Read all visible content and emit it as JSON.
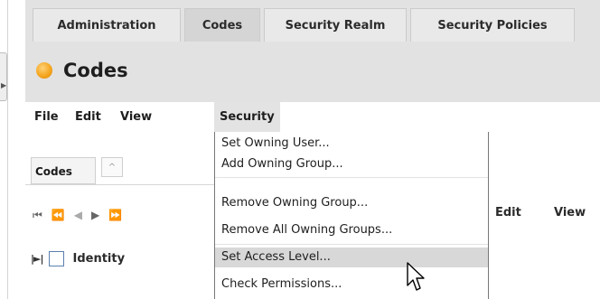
{
  "header": {
    "tabs": [
      {
        "label": "Administration",
        "active": false
      },
      {
        "label": "Codes",
        "active": true
      },
      {
        "label": "Security Realm",
        "active": false
      },
      {
        "label": "Security Policies",
        "active": false
      }
    ],
    "title": "Codes",
    "status_icon": "orange-dot-icon"
  },
  "menubar": {
    "items": [
      "File",
      "Edit",
      "View",
      "Security"
    ]
  },
  "security_menu": {
    "items": [
      "Set Owning User...",
      "Add Owning Group...",
      "Remove Owning Group...",
      "Remove All Owning Groups...",
      "Set Access Level...",
      "Check Permissions..."
    ],
    "hovered": "Set Access Level..."
  },
  "codes_panel": {
    "tab_label": "Codes",
    "collapse_glyph": "^",
    "pager_icons": [
      "first-page-icon",
      "prev-page-icon",
      "prev-icon",
      "next-icon",
      "last-page-icon"
    ],
    "toolbar_right": {
      "edit": "Edit",
      "view": "View"
    },
    "column_header": "Identity"
  },
  "colors": {
    "header_bg": "#e2e2e2",
    "accent_orange": "#f4a620",
    "hover_bg": "#d8d8d8"
  }
}
